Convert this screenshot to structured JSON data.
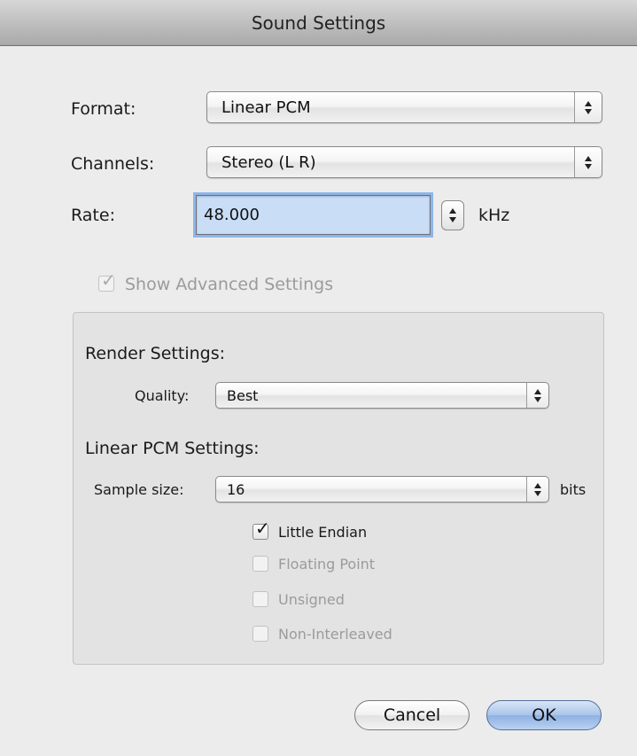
{
  "window": {
    "title": "Sound Settings"
  },
  "format": {
    "label": "Format:",
    "value": "Linear PCM"
  },
  "channels": {
    "label": "Channels:",
    "value": "Stereo (L R)"
  },
  "rate": {
    "label": "Rate:",
    "value": "48.000",
    "unit": "kHz"
  },
  "advanced": {
    "label": "Show Advanced Settings",
    "checked": true,
    "enabled": false
  },
  "render": {
    "heading": "Render Settings:",
    "quality_label": "Quality:",
    "quality_value": "Best"
  },
  "pcm": {
    "heading": "Linear PCM Settings:",
    "sample_size_label": "Sample size:",
    "sample_size_value": "16",
    "sample_size_unit": "bits",
    "options": [
      {
        "label": "Little Endian",
        "checked": true,
        "enabled": true
      },
      {
        "label": "Floating Point",
        "checked": false,
        "enabled": false
      },
      {
        "label": "Unsigned",
        "checked": false,
        "enabled": false
      },
      {
        "label": "Non-Interleaved",
        "checked": false,
        "enabled": false
      }
    ]
  },
  "buttons": {
    "cancel": "Cancel",
    "ok": "OK"
  },
  "colors": {
    "window_bg": "#ececec",
    "default_button": "#8eb1e2",
    "focus_ring": "#8db5ea"
  }
}
